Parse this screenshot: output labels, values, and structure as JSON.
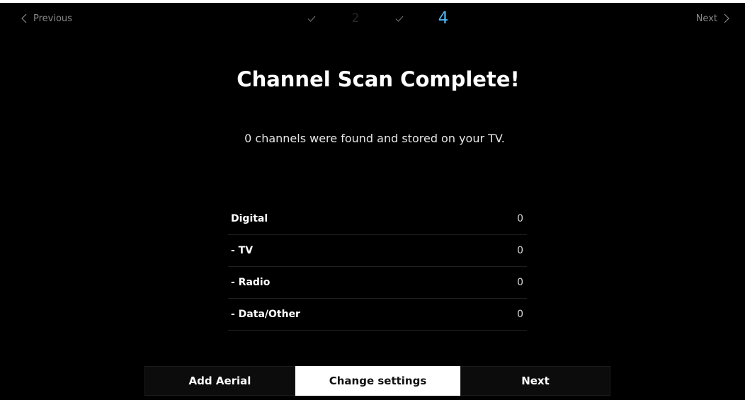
{
  "topbar": {
    "previous_label": "Previous",
    "next_label": "Next",
    "steps": [
      {
        "state": "done",
        "text": "✓"
      },
      {
        "state": "pending",
        "text": "2"
      },
      {
        "state": "done",
        "text": "✓"
      },
      {
        "state": "active",
        "text": "4"
      }
    ]
  },
  "main": {
    "title": "Channel Scan Complete!",
    "subtitle": "0 channels were found and stored on your TV.",
    "results": [
      {
        "label": "Digital",
        "value": "0"
      },
      {
        "label": "- TV",
        "value": "0"
      },
      {
        "label": "- Radio",
        "value": "0"
      },
      {
        "label": "- Data/Other",
        "value": "0"
      }
    ]
  },
  "buttons": {
    "add_aerial": "Add Aerial",
    "change_settings": "Change settings",
    "next": "Next"
  },
  "colors": {
    "background": "#000000",
    "accent": "#4fb6f5",
    "focused_button": "#ffffff"
  },
  "icons": {
    "previous": "chevron-left-icon",
    "next": "chevron-right-icon",
    "step_done": "check-icon"
  }
}
